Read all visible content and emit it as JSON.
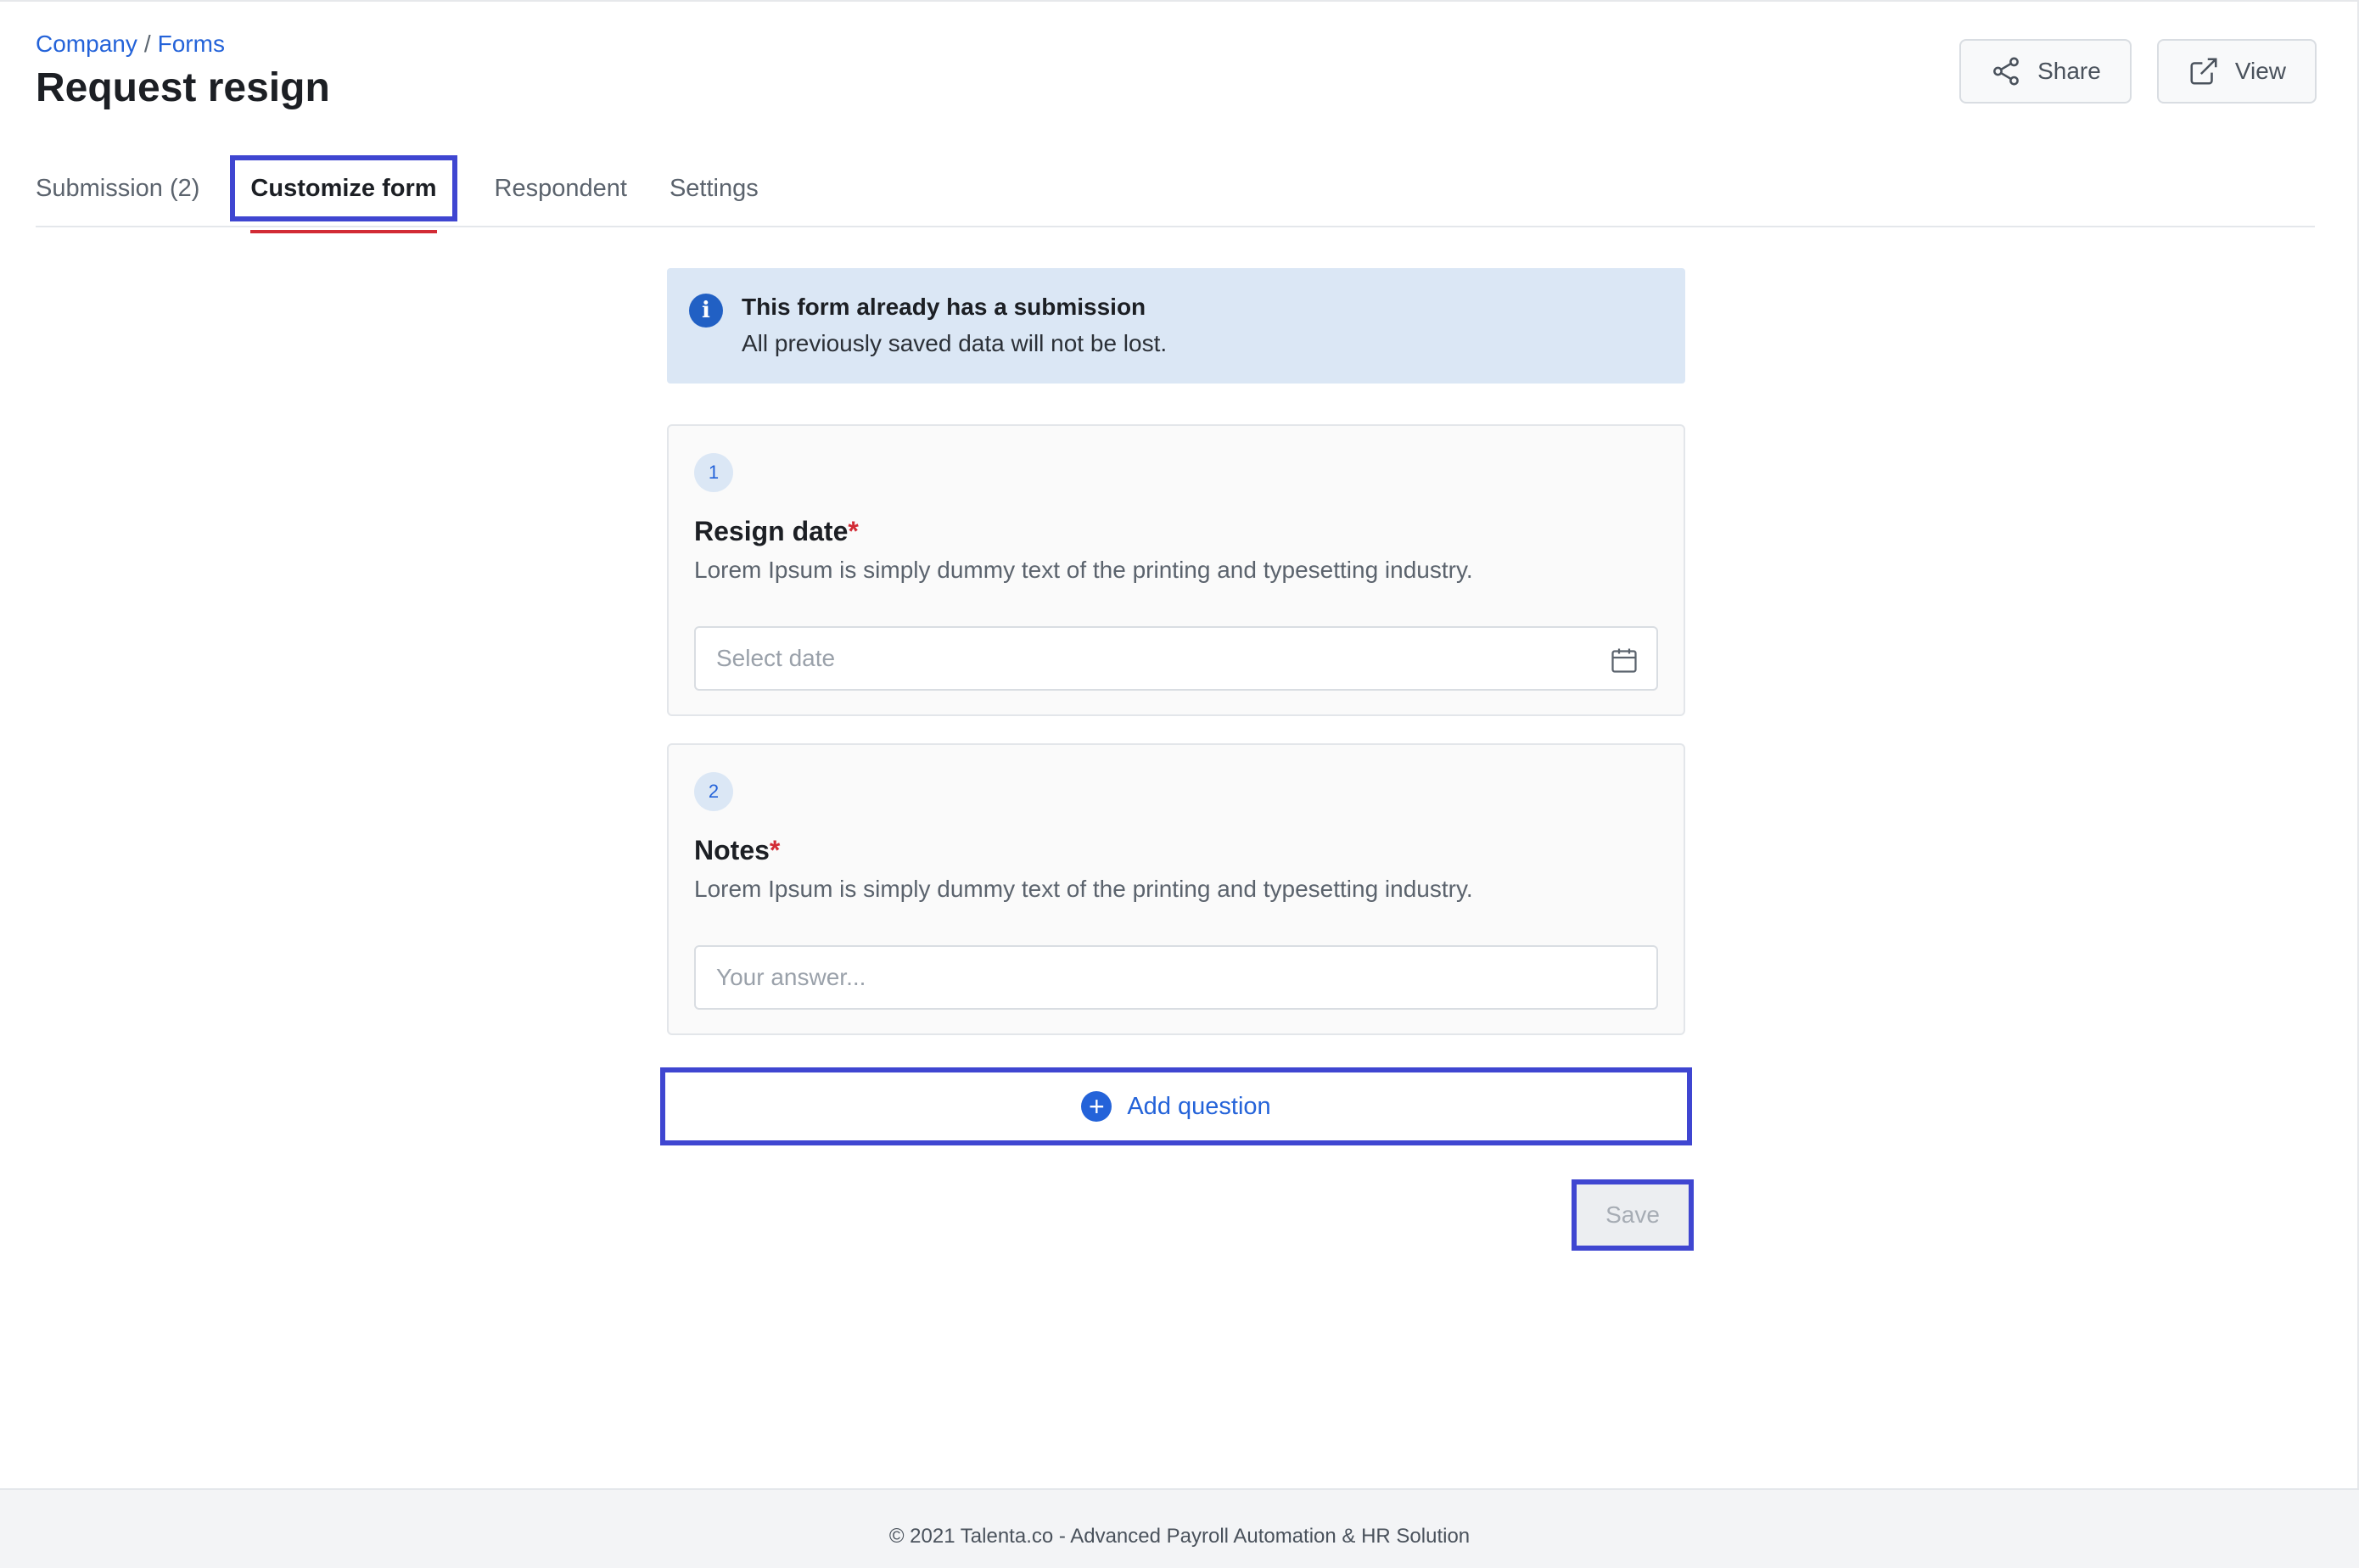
{
  "breadcrumb": {
    "items": [
      "Company",
      "Forms"
    ],
    "separator": "/"
  },
  "page": {
    "title": "Request resign"
  },
  "header_actions": {
    "share_label": "Share",
    "view_label": "View"
  },
  "tabs": [
    {
      "label": "Submission (2)",
      "active": false
    },
    {
      "label": "Customize form",
      "active": true
    },
    {
      "label": "Respondent",
      "active": false
    },
    {
      "label": "Settings",
      "active": false
    }
  ],
  "banner": {
    "title": "This form already has a submission",
    "text": "All previously saved data will not be lost."
  },
  "questions": [
    {
      "number": "1",
      "title": "Resign date",
      "required_mark": "*",
      "description": "Lorem Ipsum is simply dummy text of the printing and typesetting industry.",
      "placeholder": "Select date",
      "icon": "calendar-icon"
    },
    {
      "number": "2",
      "title": "Notes",
      "required_mark": "*",
      "description": "Lorem Ipsum is simply dummy text of the printing and typesetting industry.",
      "placeholder": "Your answer..."
    }
  ],
  "actions": {
    "add_question_label": "Add question",
    "save_label": "Save"
  },
  "footer": {
    "text": "© 2021 Talenta.co - Advanced Payroll Automation & HR Solution"
  },
  "colors": {
    "accent": "#2463d9",
    "active_tab_underline": "#d22b35",
    "highlight_outline": "#3f46d1",
    "banner_bg": "#dbe7f5"
  }
}
